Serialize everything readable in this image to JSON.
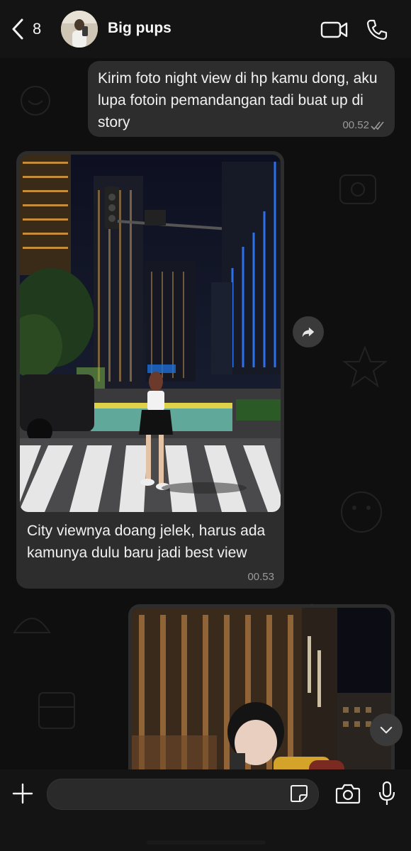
{
  "header": {
    "back_count": "8",
    "title": "Big pups",
    "icons": [
      "chevron-left-icon",
      "video-call-icon",
      "phone-icon"
    ]
  },
  "messages": [
    {
      "direction": "outgoing",
      "text": "Kirim foto night view di hp kamu dong, aku lupa fotoin pemandangan tadi buat up di story",
      "time": "00.52",
      "status": "read"
    },
    {
      "direction": "incoming",
      "type": "photo",
      "caption": "City viewnya doang jelek, harus ada kamunya dulu baru jadi best view",
      "time": "00.53"
    },
    {
      "direction": "outgoing",
      "type": "photo"
    }
  ],
  "input": {
    "placeholder": "",
    "icons": [
      "plus-icon",
      "sticker-icon",
      "camera-icon",
      "microphone-icon"
    ]
  },
  "colors": {
    "background": "#0b0b0b",
    "bubble": "#2d2d2d",
    "header": "#141414",
    "time_text": "#9a9a9a"
  }
}
